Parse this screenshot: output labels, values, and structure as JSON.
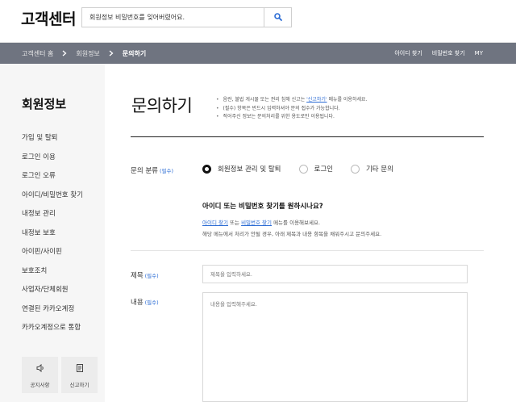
{
  "header": {
    "logo": "고객센터",
    "search_value": "회원정보 비밀번호를 잊어버렸어요.",
    "search_icon": "search-icon"
  },
  "navbar": {
    "breadcrumb": [
      "고객센터 홈",
      "회원정보",
      "문의하기"
    ],
    "links": [
      "아이디 찾기",
      "비밀번호 찾기",
      "MY"
    ]
  },
  "sidebar": {
    "title": "회원정보",
    "items": [
      "가입 및 탈퇴",
      "로그인 이용",
      "로그인 오류",
      "아이디/비밀번호 찾기",
      "내정보 관리",
      "내정보 보호",
      "아이핀/사이핀",
      "보호조치",
      "사업자/단체회원",
      "연결된 카카오계정",
      "카카오계정으로 통합"
    ],
    "cards": [
      {
        "label": "공지사항",
        "icon": "speaker-icon"
      },
      {
        "label": "신고하기",
        "icon": "document-icon"
      }
    ]
  },
  "main": {
    "title": "문의하기",
    "notices": {
      "n1_pre": "음란, 불법 게시물 또는 권리 침해 신고는 ",
      "n1_link": "'신고하기'",
      "n1_post": " 메뉴를 이용하세요.",
      "n2": "(필수) 항목은 반드시 입력하셔야 문의 접수가 가능합니다.",
      "n3": "적어주신 정보는 문의처리를 위한 용도로만 이용됩니다."
    },
    "category": {
      "label": "문의 분류",
      "required": "(필수)",
      "options": [
        "회원정보 관리 및 탈퇴",
        "로그인",
        "기타 문의"
      ],
      "selected": "회원정보 관리 및 탈퇴"
    },
    "help": {
      "title": "아이디 또는 비밀번호 찾기를 원하시나요?",
      "link1": "아이디 찾기",
      "mid": " 또는 ",
      "link2": "비밀번호 찾기",
      "tail": " 메뉴를 이용해보세요.",
      "line2": "해당 메뉴에서 처리가 안될 경우, 아래 제목과 내용 항목을 채워주시고 문의주세요."
    },
    "subject": {
      "label": "제목",
      "required": "(필수)",
      "placeholder": "제목을 입력하세요."
    },
    "content": {
      "label": "내용",
      "required": "(필수)",
      "placeholder": "내용을 입력해주세요."
    }
  }
}
